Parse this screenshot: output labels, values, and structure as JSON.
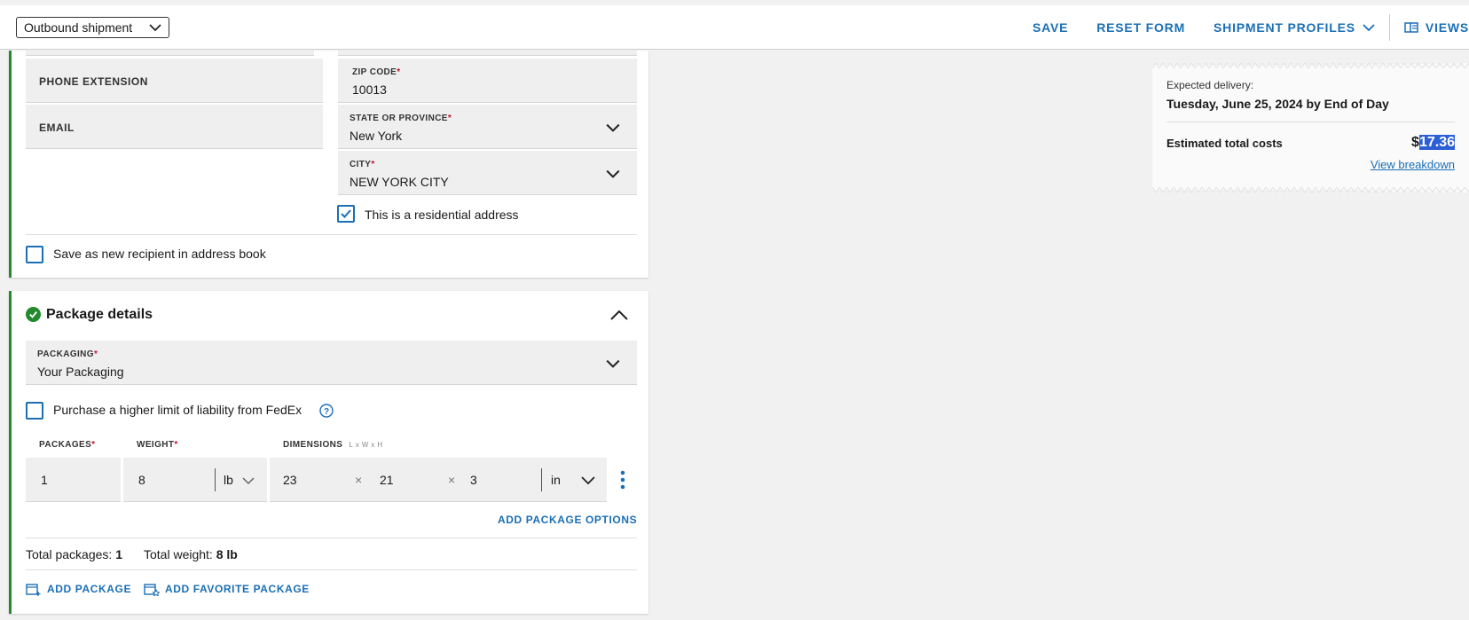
{
  "topbar": {
    "shipment_type": "Outbound shipment",
    "save": "SAVE",
    "reset": "RESET FORM",
    "profiles": "SHIPMENT PROFILES",
    "views": "VIEWS"
  },
  "recipient": {
    "phone_extension_label": "PHONE EXTENSION",
    "email_label": "EMAIL",
    "zip_label": "ZIP CODE",
    "zip_value": "10013",
    "state_label": "STATE OR PROVINCE",
    "state_value": "New York",
    "city_label": "CITY",
    "city_value": "NEW YORK CITY",
    "residential_label": "This is a residential address",
    "save_recipient_label": "Save as new recipient in address book"
  },
  "package": {
    "title": "Package details",
    "packaging_label": "PACKAGING",
    "packaging_value": "Your Packaging",
    "liability_label": "Purchase a higher limit of liability from FedEx",
    "packages_label": "PACKAGES",
    "weight_label": "WEIGHT",
    "dimensions_label": "DIMENSIONS",
    "dimensions_hint": "L x W x H",
    "packages_value": "1",
    "weight_value": "8",
    "weight_unit": "lb",
    "dim_l": "23",
    "dim_w": "21",
    "dim_h": "3",
    "dim_x": "×",
    "dim_unit": "in",
    "add_options": "ADD PACKAGE OPTIONS",
    "total_packages_label": "Total packages:",
    "total_packages_value": "1",
    "total_weight_label": "Total weight:",
    "total_weight_value": "8 lb",
    "add_package": "ADD PACKAGE",
    "add_favorite": "ADD FAVORITE PACKAGE"
  },
  "summary": {
    "expected_label": "Expected delivery:",
    "expected_value": "Tuesday, June 25, 2024 by End of Day",
    "total_label": "Estimated total costs",
    "currency": "$",
    "total_value": "17.36",
    "breakdown": "View breakdown"
  },
  "colors": {
    "accent": "#1b6fb5",
    "success": "#238a2c",
    "required": "#c8102e"
  }
}
